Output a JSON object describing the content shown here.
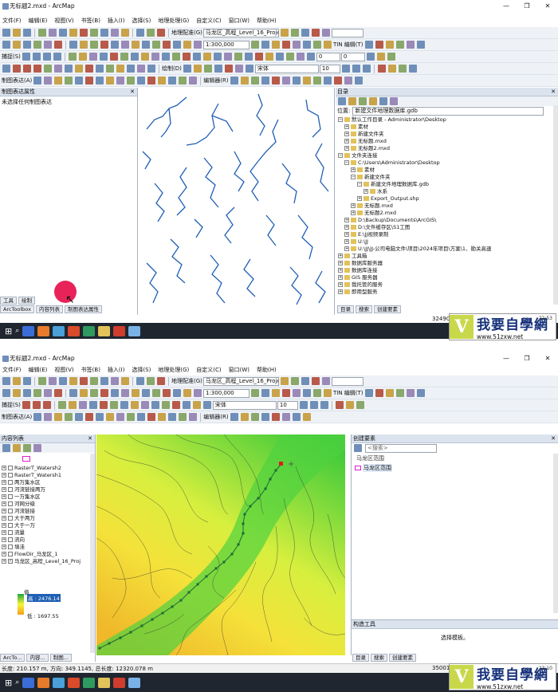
{
  "top": {
    "title": "无标题2.mxd - ArcMap",
    "menus": [
      "文件(F)",
      "编辑(E)",
      "视图(V)",
      "书签(B)",
      "插入(I)",
      "选择(S)",
      "地理处理(G)",
      "自定义(C)",
      "窗口(W)",
      "帮助(H)"
    ],
    "georef": "地理配准(G)",
    "layer": "马龙区_高程_Level_16_Proje",
    "tin": "TIN 编辑(T)",
    "scale": "1:300,000",
    "num1": "0",
    "num2": "0",
    "capture": "捕捉(S)",
    "draw": "绘制(D)",
    "font": "宋体",
    "fontsize": "10",
    "editor": "编辑器(R)",
    "repr": "制图表达(A)",
    "left_panel_title": "制图表达属性",
    "left_msg": "未选择任何制图表达",
    "left_tabs": [
      "工具",
      "绘制"
    ],
    "bottom_tabs": [
      "ArcToolbox",
      "内容列表",
      "制图表达属性"
    ],
    "catalog": {
      "title": "目录",
      "location_label": "位置:",
      "location": "新建文件地理数据库.gdb",
      "items": [
        {
          "t": "默认工作目录 - Administrator\\Desktop",
          "l": 0
        },
        {
          "t": "素材",
          "l": 1
        },
        {
          "t": "新建文件夹",
          "l": 1
        },
        {
          "t": "无标题.mxd",
          "l": 1
        },
        {
          "t": "无标题2.mxd",
          "l": 1
        },
        {
          "t": "文件夹连接",
          "l": 0
        },
        {
          "t": "C:\\Users\\Administrator\\Desktop",
          "l": 1
        },
        {
          "t": "素材",
          "l": 2
        },
        {
          "t": "新建文件夹",
          "l": 2
        },
        {
          "t": "新建文件地理数据库.gdb",
          "l": 3
        },
        {
          "t": "水系",
          "l": 4
        },
        {
          "t": "Export_Output.shp",
          "l": 3
        },
        {
          "t": "无标题.mxd",
          "l": 2
        },
        {
          "t": "无标题2.mxd",
          "l": 2
        },
        {
          "t": "D:\\Backup\\Documents\\ArcGIS\\",
          "l": 1
        },
        {
          "t": "D:\\文件缓存区\\S1工图",
          "l": 1
        },
        {
          "t": "E:\\JJ视频录制",
          "l": 1
        },
        {
          "t": "U:\\JJ",
          "l": 1
        },
        {
          "t": "U:\\JJ\\JJ-公司电脑文件\\项目\\2024年项目\\方案\\1、勘关高速",
          "l": 1
        },
        {
          "t": "工具箱",
          "l": 0
        },
        {
          "t": "数据库服务器",
          "l": 0
        },
        {
          "t": "数据库连接",
          "l": 0
        },
        {
          "t": "GIS 服务器",
          "l": 0
        },
        {
          "t": "我托管的服务",
          "l": 0
        },
        {
          "t": "即用型服务",
          "l": 0
        }
      ],
      "tabs": [
        "目录",
        "搜索",
        "创建要素"
      ]
    },
    "status": "32490"
  },
  "bottom": {
    "title": "无标题2.mxd - ArcMap",
    "toc_title": "内容列表",
    "layers": [
      "RasterT_Watersh2",
      "RasterT_Watersh1",
      "两万集水区",
      "河流链接两万",
      "一万集水区",
      "河网分级",
      "河流链接",
      "大于两万",
      "大于一万",
      "流量",
      "流向",
      "填洼",
      "FlowDir_马龙区_1",
      "马龙区_高程_Level_16_Proj"
    ],
    "legend_value": "值",
    "legend_high": "高 : 2476.14",
    "legend_low": "低 : 1697.55",
    "create_title": "创建要素",
    "search_ph": "<搜索>",
    "feat_group": "马龙区范围",
    "feat_item": "马龙区范围",
    "construct_title": "构造工具",
    "construct_msg": "选择模板。",
    "bottom_tabs": [
      "ArcTo...",
      "内容...",
      "制图..."
    ],
    "right_tabs": [
      "目录",
      "搜索",
      "创建要素"
    ],
    "status": "长度: 210.157 m, 方向: 349.1145, 总长度: 12320.078 m",
    "status_right": "35001"
  },
  "taskbar": {
    "time1": "22:53",
    "time2": "23:10"
  },
  "watermark": {
    "logo": "V",
    "text": "我要自學網",
    "url": "www.51zxw.net"
  },
  "colors": {
    "accent": "#1f5fb4",
    "river": "#1f5fb4",
    "taskbar": "#1f2630"
  }
}
